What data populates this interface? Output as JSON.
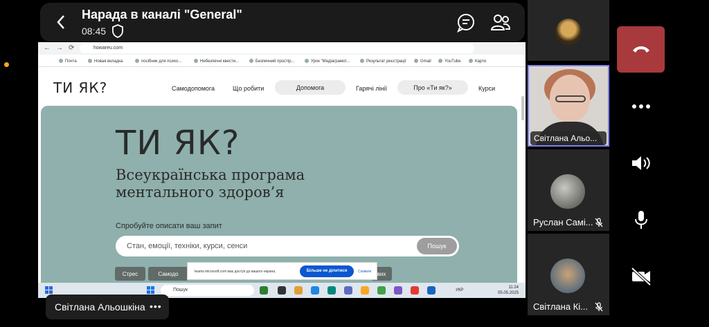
{
  "meeting": {
    "title": "Нарада в каналі \"General\"",
    "time": "08:45"
  },
  "browser": {
    "url": "howareu.com",
    "bookmarks": [
      "Почта",
      "Новая вкладка",
      "посібник для психо...",
      "Небезпечні квести...",
      "Безпечний простір...",
      "Урок \"Медіаграмот...",
      "Результат реєстрації",
      "Gmail",
      "YouTube",
      "Карти"
    ]
  },
  "site": {
    "logo": "ТИ ЯК?",
    "nav": [
      "Самодопомога",
      "Що робити",
      "Допомога",
      "Гарячі лінії",
      "Про «Ти як?»",
      "Курси"
    ],
    "hero_logo": "ТИ ЯК?",
    "subtitle": "Всеукраїнська програма ментального здоров’я",
    "search_label": "Спробуйте описати ваш запит",
    "search_placeholder": "Стан, емоції, техніки, курси, сенси",
    "search_button": "Пошук",
    "chips": [
      "Стрес",
      "Самодо",
      "вих"
    ]
  },
  "share_notice": {
    "text": "teams.microsoft.com має доступ до вашого екрана.",
    "stop_label": "Більше не ділитися",
    "hide_label": "Сховати"
  },
  "taskbar": {
    "search_placeholder": "Пошук",
    "language": "УКР",
    "time": "11:24",
    "date": "05.05.2025"
  },
  "presenter": {
    "name": "Світлана Альошкіна"
  },
  "participants": [
    {
      "name": "Світлана Альо..."
    },
    {
      "name": "Руслан Самі..."
    },
    {
      "name": "Світлана Кі..."
    }
  ],
  "colors": {
    "hero_bg": "#8fb0ac",
    "hangup": "#a8393d",
    "active_speaker_border": "#7b83eb",
    "notice_button": "#0b57d0"
  }
}
